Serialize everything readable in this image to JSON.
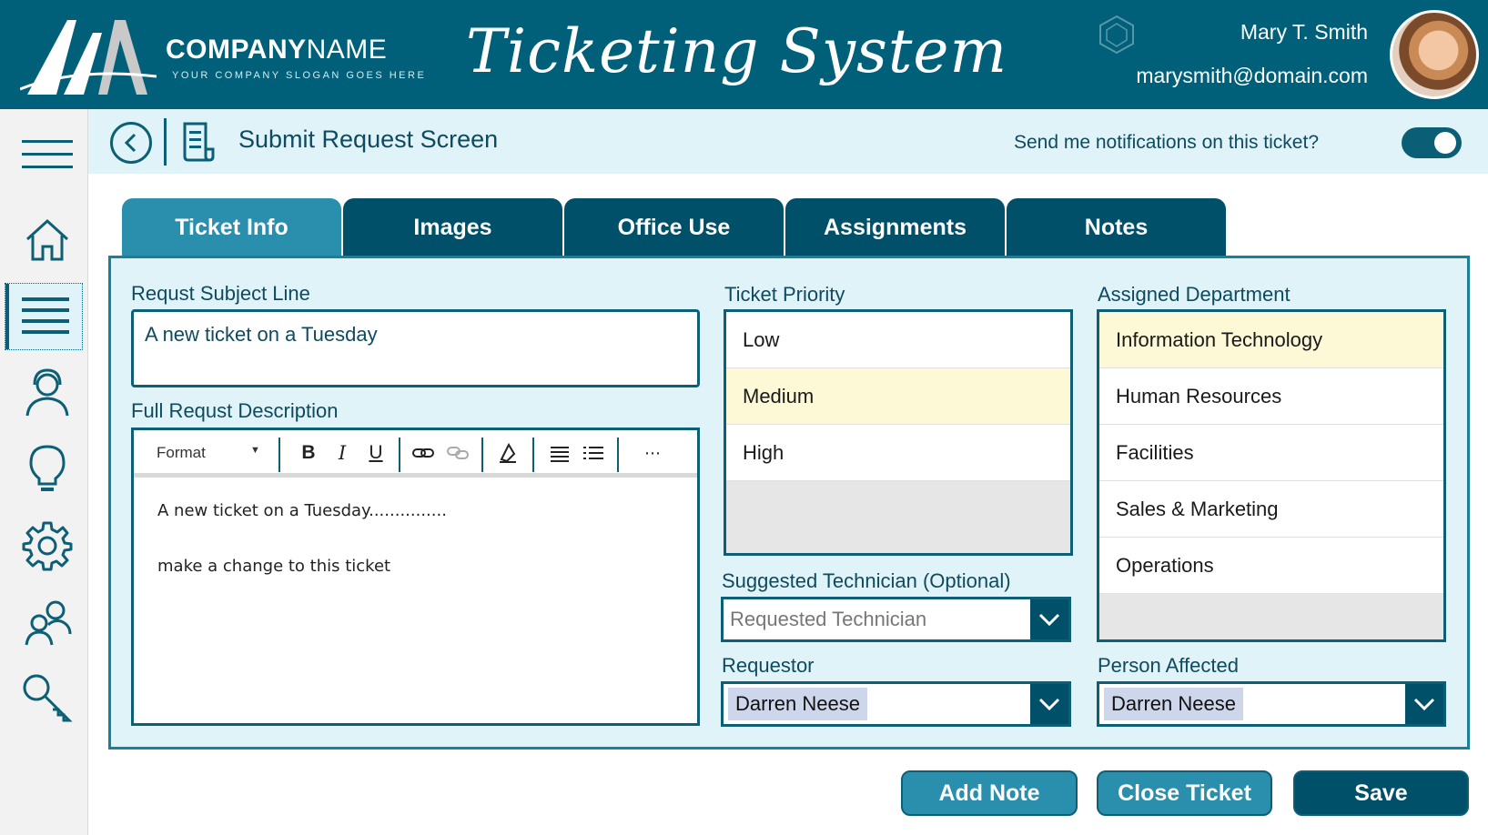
{
  "header": {
    "company_name_bold": "COMPANY",
    "company_name_light": "NAME",
    "slogan": "YOUR COMPANY SLOGAN GOES HERE",
    "app_title": "Ticketing System",
    "user_name": "Mary T. Smith",
    "user_email": "marysmith@domain.com"
  },
  "sidebar": {
    "items": [
      {
        "icon": "menu-icon"
      },
      {
        "icon": "home-icon"
      },
      {
        "icon": "list-icon",
        "active": true
      },
      {
        "icon": "support-agent-icon"
      },
      {
        "icon": "lightbulb-icon"
      },
      {
        "icon": "gear-icon"
      },
      {
        "icon": "users-icon"
      },
      {
        "icon": "key-icon"
      }
    ]
  },
  "subheader": {
    "screen_title": "Submit Request Screen",
    "notify_label": "Send me notifications on this ticket?",
    "notify_enabled": true
  },
  "tabs": [
    {
      "label": "Ticket Info",
      "active": true
    },
    {
      "label": "Images"
    },
    {
      "label": "Office Use"
    },
    {
      "label": "Assignments"
    },
    {
      "label": "Notes"
    }
  ],
  "form": {
    "subject_label": "Requst Subject Line",
    "subject_value": "A new ticket on a Tuesday",
    "description_label": "Full Requst Description",
    "editor": {
      "format_label": "Format",
      "lines": [
        "A new ticket on a Tuesday...............",
        "make a change to this ticket"
      ]
    },
    "priority_label": "Ticket Priority",
    "priority_options": [
      "Low",
      "Medium",
      "High"
    ],
    "priority_selected": "Medium",
    "technician_label": "Suggested Technician (Optional)",
    "technician_placeholder": "Requested Technician",
    "requestor_label": "Requestor",
    "requestor_value": "Darren Neese",
    "department_label": "Assigned Department",
    "department_options": [
      "Information Technology",
      "Human Resources",
      "Facilities",
      "Sales & Marketing",
      "Operations"
    ],
    "department_selected": "Information Technology",
    "affected_label": "Person Affected",
    "affected_value": "Darren Neese"
  },
  "actions": {
    "add_note": "Add Note",
    "close_ticket": "Close Ticket",
    "save": "Save"
  },
  "colors": {
    "primary_dark": "#00506a",
    "header": "#00607a",
    "accent": "#2a8fac",
    "panel_bg": "#dff3f8",
    "selected_row": "#fdf8d5"
  }
}
